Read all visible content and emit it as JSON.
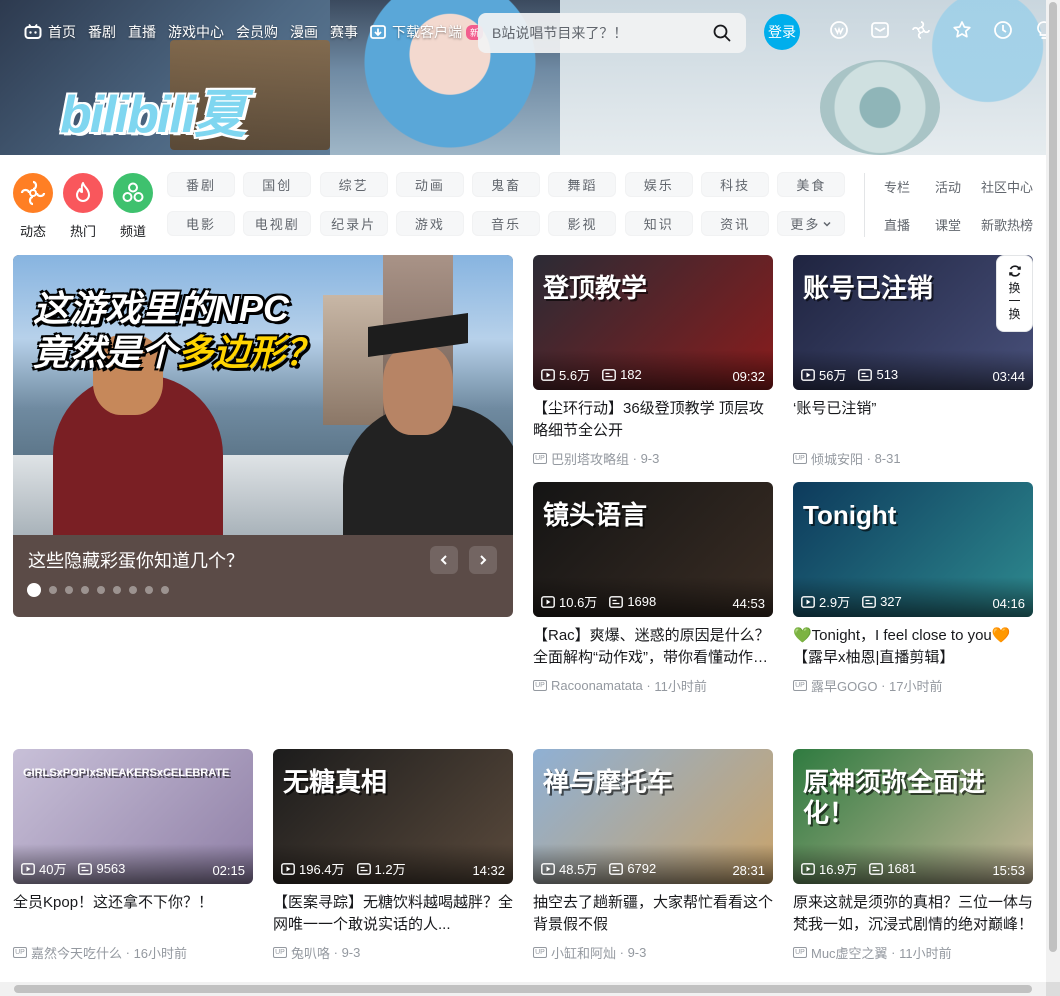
{
  "nav": {
    "items": [
      {
        "label": "首页",
        "icon": "tv-icon"
      },
      {
        "label": "番剧"
      },
      {
        "label": "直播"
      },
      {
        "label": "游戏中心"
      },
      {
        "label": "会员购"
      },
      {
        "label": "漫画"
      },
      {
        "label": "赛事"
      },
      {
        "label": "下载客户端",
        "icon": "download-icon",
        "badge": "新"
      }
    ],
    "search_placeholder": "B站说唱节目来了？！",
    "login": "登录",
    "right_icons": [
      "vip-icon",
      "message-icon",
      "dynamic-icon",
      "favorite-icon",
      "history-icon",
      "creator-icon"
    ]
  },
  "banner": {
    "logo": "bilibili夏"
  },
  "channels": {
    "round": [
      {
        "label": "动态",
        "color": "#ff7f24"
      },
      {
        "label": "热门",
        "color": "#f9575c"
      },
      {
        "label": "频道",
        "color": "#3ec16e"
      }
    ],
    "chips": [
      "番剧",
      "国创",
      "综艺",
      "动画",
      "鬼畜",
      "舞蹈",
      "娱乐",
      "科技",
      "美食",
      "电影",
      "电视剧",
      "纪录片",
      "游戏",
      "音乐",
      "影视",
      "知识",
      "资讯",
      "更多"
    ],
    "extra": [
      "专栏",
      "活动",
      "社区中心",
      "直播",
      "课堂",
      "新歌热榜"
    ]
  },
  "carousel": {
    "image_text_line1": "这游戏里的NPC",
    "image_text_line2a": "竟然是个",
    "image_text_line2b": "多边形？",
    "caption": "这些隐藏彩蛋你知道几个？",
    "dot_count": 9,
    "active_dot": 0
  },
  "refresh": {
    "label": [
      "换",
      "一",
      "换"
    ]
  },
  "videos": [
    {
      "views": "5.6万",
      "danmaku": "182",
      "duration": "09:32",
      "title": "【尘环行动】36级登顶教学 顶层攻略细节全公开",
      "author": "巴别塔攻略组",
      "date": "9-3",
      "thumb_text": "登顶教学",
      "bg": [
        "#2b2b35",
        "#8a1c1c"
      ]
    },
    {
      "views": "56万",
      "danmaku": "513",
      "duration": "03:44",
      "title": "‘账号已注销”",
      "author": "倾城安阳",
      "date": "8-31",
      "thumb_text": "账号已注销",
      "bg": [
        "#1f2440",
        "#48507a"
      ]
    },
    {
      "views": "10.6万",
      "danmaku": "1698",
      "duration": "44:53",
      "title": "【Rac】爽爆、迷惑的原因是什么？全面解构“动作戏”，带你看懂动作片的镜头语言",
      "author": "Racoonamatata",
      "date": "11小时前",
      "thumb_text": "镜头语言",
      "bg": [
        "#141414",
        "#3a2d24"
      ]
    },
    {
      "views": "2.9万",
      "danmaku": "327",
      "duration": "04:16",
      "title": "💚Tonight，I feel close to you🧡【露早x柚恩|直播剪辑】",
      "author": "露早GOGO",
      "date": "17小时前",
      "thumb_text": "Tonight",
      "bg": [
        "#0d3a5c",
        "#2e8a8f"
      ]
    },
    {
      "views": "40万",
      "danmaku": "9563",
      "duration": "02:15",
      "title": "全员Kpop！这还拿不下你？！",
      "author": "嘉然今天吃什么",
      "date": "16小时前",
      "thumb_text": "GIRLSxPOP!xSNEAKERSxCELEBRATE",
      "bg": [
        "#c8c0d8",
        "#8f7fa6"
      ]
    },
    {
      "views": "196.4万",
      "danmaku": "1.2万",
      "duration": "14:32",
      "title": "【医案寻踪】无糖饮料越喝越胖？全网唯一一个敢说实话的人...",
      "author": "兔叭咯",
      "date": "9-3",
      "thumb_text": "无糖真相",
      "bg": [
        "#1c1c1c",
        "#5a4a3c"
      ]
    },
    {
      "views": "48.5万",
      "danmaku": "6792",
      "duration": "28:31",
      "title": "抽空去了趟新疆，大家帮忙看看这个背景假不假",
      "author": "小缸和阿灿",
      "date": "9-3",
      "thumb_text": "禅与摩托车",
      "bg": [
        "#8fb0d4",
        "#c9a36a"
      ]
    },
    {
      "views": "16.9万",
      "danmaku": "1681",
      "duration": "15:53",
      "title": "原来这就是须弥的真相？三位一体与梵我一如，沉浸式剧情的绝对巅峰！",
      "author": "Muc虚空之翼",
      "date": "11小时前",
      "thumb_text": "原神须弥全面进化！",
      "bg": [
        "#2f7b40",
        "#c8b89a"
      ]
    }
  ]
}
